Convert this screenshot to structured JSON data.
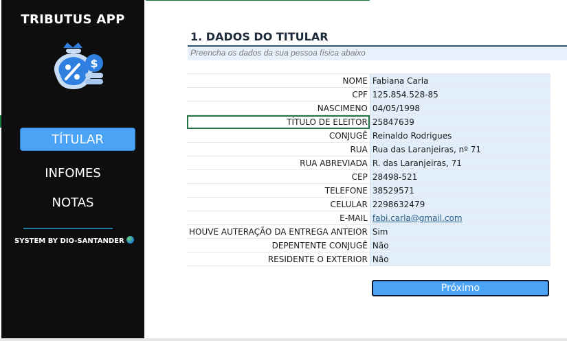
{
  "sidebar": {
    "app_title": "TRIBUTUS APP",
    "logo_icon": "money-bag-icon",
    "nav": [
      {
        "label": "TÍTULAR",
        "active": true
      },
      {
        "label": "INFOMES",
        "active": false
      },
      {
        "label": "NOTAS",
        "active": false
      }
    ],
    "credits": "SYSTEM BY DIO-SANTANDER",
    "credits_icon": "globe-icon"
  },
  "main": {
    "section_title": "1. DADOS DO TITULAR",
    "subtitle": "Preencha os dados da sua pessoa física abaixo",
    "fields": [
      {
        "label": "NOME",
        "value": "Fabiana Carla"
      },
      {
        "label": "CPF",
        "value": "125.854.528-85"
      },
      {
        "label": "NASCIMENO",
        "value": "04/05/1998"
      },
      {
        "label": "TÍTULO DE ELEITOR",
        "value": "25847639",
        "selected": true
      },
      {
        "label": "CONJUGÊ",
        "value": "Reinaldo Rodrigues"
      },
      {
        "label": "RUA",
        "value": "Rua das Laranjeiras, nº 71"
      },
      {
        "label": "RUA ABREVIADA",
        "value": "R. das Laranjeiras, 71"
      },
      {
        "label": "CEP",
        "value": "28498-521"
      },
      {
        "label": "TELEFONE",
        "value": "38529571"
      },
      {
        "label": "CELULAR",
        "value": "2298632479"
      },
      {
        "label": "E-MAIL",
        "value": "fabi.carla@gmail.com",
        "link": true
      },
      {
        "label": "HOUVE AUTERAÇÃO DA ENTREGA ANTEIOR",
        "value": "Sim"
      },
      {
        "label": "DEPENTENTE CONJUGÊ",
        "value": "Não"
      },
      {
        "label": "RESIDENTE O EXTERIOR",
        "value": "Não"
      }
    ],
    "next_button": "Próximo"
  },
  "colors": {
    "sidebar_bg": "#0e0e0e",
    "accent_blue": "#4ba3f5",
    "value_bg": "#e2eefa",
    "selection_green": "#217346"
  }
}
